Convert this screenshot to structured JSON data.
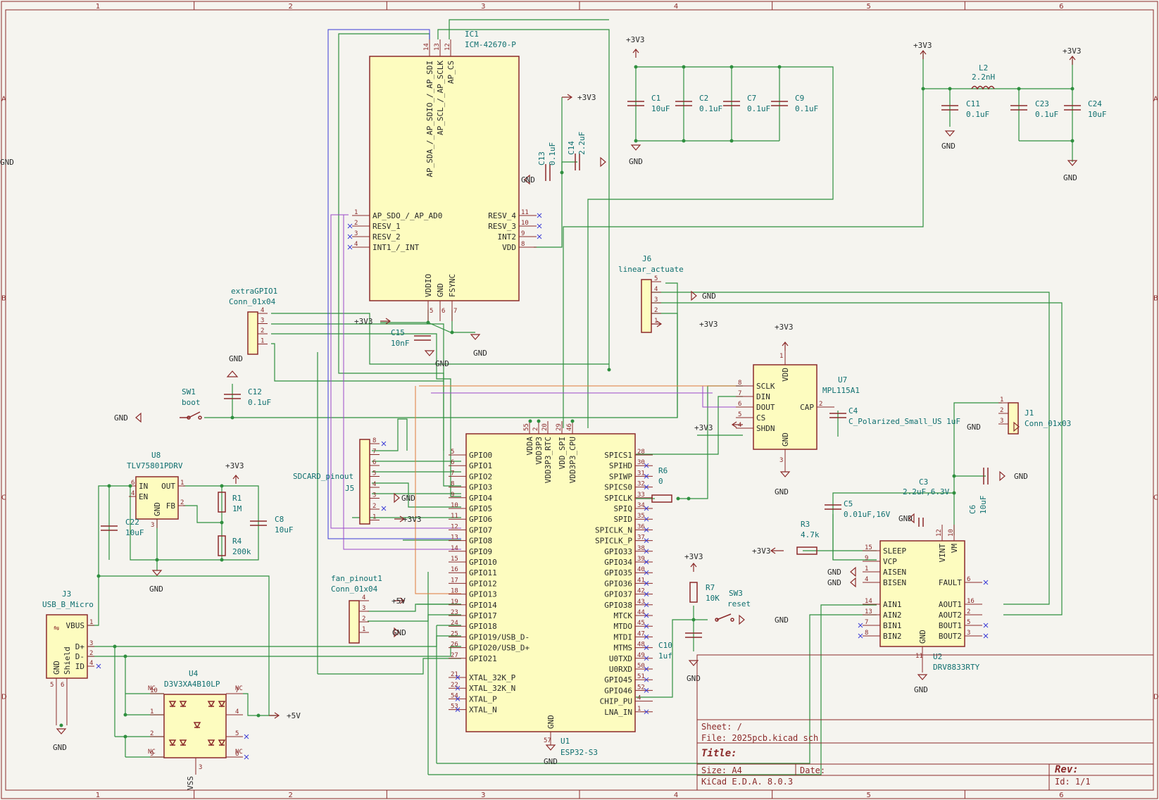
{
  "grid": {
    "cols": [
      "1",
      "2",
      "3",
      "4",
      "5",
      "6"
    ],
    "rows": [
      "A",
      "B",
      "C",
      "D"
    ]
  },
  "ic1": {
    "ref": "IC1",
    "value": "ICM-42670-P",
    "top_pins": [
      {
        "num": "14",
        "name": "AP_SDA_/_AP_SDIO_/_AP_SDI"
      },
      {
        "num": "13",
        "name": "AP_SCL_/_AP_SCLK"
      },
      {
        "num": "12",
        "name": "AP_CS"
      }
    ],
    "left_pins": [
      {
        "num": "1",
        "name": "AP_SDO_/_AP_AD0"
      },
      {
        "num": "2",
        "name": "RESV_1"
      },
      {
        "num": "3",
        "name": "RESV_2"
      },
      {
        "num": "4",
        "name": "INT1_/_INT"
      }
    ],
    "right_pins": [
      {
        "num": "11",
        "name": "RESV_4"
      },
      {
        "num": "10",
        "name": "RESV_3"
      },
      {
        "num": "9",
        "name": "INT2"
      },
      {
        "num": "8",
        "name": "VDD"
      }
    ],
    "bottom_pins": [
      {
        "num": "5",
        "name": "VDDIO"
      },
      {
        "num": "6",
        "name": "GND"
      },
      {
        "num": "7",
        "name": "FSYNC"
      }
    ]
  },
  "u1": {
    "ref": "U1",
    "value": "ESP32-S3",
    "top_pins": [
      {
        "num": "55",
        "name": "VDDA"
      },
      {
        "num": "2",
        "name": "VDD3P3"
      },
      {
        "num": "20",
        "name": "VDD3P3_RTC"
      },
      {
        "num": "29",
        "name": "VDD_SPI"
      },
      {
        "num": "46",
        "name": "VDD3P3_CPU"
      }
    ],
    "left_pins": [
      {
        "num": "5",
        "name": "GPIO0"
      },
      {
        "num": "6",
        "name": "GPIO1"
      },
      {
        "num": "7",
        "name": "GPIO2"
      },
      {
        "num": "8",
        "name": "GPIO3"
      },
      {
        "num": "9",
        "name": "GPIO4"
      },
      {
        "num": "10",
        "name": "GPIO5"
      },
      {
        "num": "11",
        "name": "GPIO6"
      },
      {
        "num": "12",
        "name": "GPIO7"
      },
      {
        "num": "13",
        "name": "GPIO8"
      },
      {
        "num": "14",
        "name": "GPIO9"
      },
      {
        "num": "15",
        "name": "GPIO10"
      },
      {
        "num": "16",
        "name": "GPIO11"
      },
      {
        "num": "17",
        "name": "GPIO12"
      },
      {
        "num": "18",
        "name": "GPIO13"
      },
      {
        "num": "19",
        "name": "GPIO14"
      },
      {
        "num": "23",
        "name": "GPIO17"
      },
      {
        "num": "24",
        "name": "GPIO18"
      },
      {
        "num": "25",
        "name": "GPIO19/USB_D-"
      },
      {
        "num": "26",
        "name": "GPIO20/USB_D+"
      },
      {
        "num": "27",
        "name": "GPIO21"
      },
      {
        "num": "21",
        "name": "XTAL_32K_P"
      },
      {
        "num": "22",
        "name": "XTAL_32K_N"
      },
      {
        "num": "54",
        "name": "XTAL_P"
      },
      {
        "num": "53",
        "name": "XTAL_N"
      }
    ],
    "right_pins": [
      {
        "num": "28",
        "name": "SPICS1"
      },
      {
        "num": "30",
        "name": "SPIHD"
      },
      {
        "num": "31",
        "name": "SPIWP"
      },
      {
        "num": "32",
        "name": "SPICS0"
      },
      {
        "num": "33",
        "name": "SPICLK"
      },
      {
        "num": "34",
        "name": "SPIQ"
      },
      {
        "num": "35",
        "name": "SPID"
      },
      {
        "num": "36",
        "name": "SPICLK_N"
      },
      {
        "num": "37",
        "name": "SPICLK_P"
      },
      {
        "num": "38",
        "name": "GPIO33"
      },
      {
        "num": "39",
        "name": "GPIO34"
      },
      {
        "num": "40",
        "name": "GPIO35"
      },
      {
        "num": "41",
        "name": "GPIO36"
      },
      {
        "num": "42",
        "name": "GPIO37"
      },
      {
        "num": "43",
        "name": "GPIO38"
      },
      {
        "num": "44",
        "name": "MTCK"
      },
      {
        "num": "45",
        "name": "MTDO"
      },
      {
        "num": "47",
        "name": "MTDI"
      },
      {
        "num": "48",
        "name": "MTMS"
      },
      {
        "num": "49",
        "name": "U0TXD"
      },
      {
        "num": "50",
        "name": "U0RXD"
      },
      {
        "num": "51",
        "name": "GPIO45"
      },
      {
        "num": "52",
        "name": "GPIO46"
      },
      {
        "num": "4",
        "name": "CHIP_PU"
      },
      {
        "num": "1",
        "name": "LNA_IN"
      }
    ],
    "bottom_pins": [
      {
        "num": "57",
        "name": "GND"
      }
    ]
  },
  "u7": {
    "ref": "U7",
    "value": "MPL115A1",
    "left_pins": [
      {
        "num": "8",
        "name": "SCLK"
      },
      {
        "num": "7",
        "name": "DIN"
      },
      {
        "num": "6",
        "name": "DOUT"
      },
      {
        "num": "5",
        "name": "CS"
      },
      {
        "num": "4",
        "name": "SHDN"
      }
    ],
    "top_pin": {
      "num": "1",
      "name": "VDD"
    },
    "bottom_pin": {
      "num": "3",
      "name": "GND"
    },
    "right_pin": {
      "num": "2",
      "name": "CAP"
    }
  },
  "u2": {
    "ref": "U2",
    "value": "DRV8833RTY",
    "left_pins": [
      {
        "num": "15",
        "name": "SLEEP"
      },
      {
        "num": "9",
        "name": "VCP"
      },
      {
        "num": "1",
        "name": "AISEN"
      },
      {
        "num": "4",
        "name": "BISEN"
      },
      {
        "num": "14",
        "name": "AIN1"
      },
      {
        "num": "13",
        "name": "AIN2"
      },
      {
        "num": "7",
        "name": "BIN1"
      },
      {
        "num": "8",
        "name": "BIN2"
      }
    ],
    "right_pins": [
      {
        "num": "6",
        "name": "FAULT"
      },
      {
        "num": "16",
        "name": "AOUT1"
      },
      {
        "num": "2",
        "name": "AOUT2"
      },
      {
        "num": "5",
        "name": "BOUT1"
      },
      {
        "num": "3",
        "name": "BOUT2"
      }
    ],
    "top_pins": [
      {
        "num": "12",
        "name": "VINT"
      },
      {
        "num": "10",
        "name": "VM"
      }
    ],
    "bottom_pin": {
      "num": "11",
      "name": "GND"
    }
  },
  "u8": {
    "ref": "U8",
    "value": "TLV75801PDRV",
    "pins": [
      {
        "num": "6",
        "name": "IN"
      },
      {
        "num": "4",
        "name": "EN"
      },
      {
        "num": "1",
        "name": "OUT"
      },
      {
        "num": "2",
        "name": "FB"
      },
      {
        "num": "3",
        "name": "GND"
      }
    ]
  },
  "u4": {
    "ref": "U4",
    "value": "D3V3XA4B10LP",
    "nc": "NC",
    "vss": "VSS",
    "pins": [
      "10",
      "1",
      "2",
      "9",
      "7",
      "4",
      "5",
      "6",
      "3"
    ]
  },
  "j3": {
    "ref": "J3",
    "value": "USB_B_Micro",
    "pins": [
      {
        "num": "1",
        "name": "VBUS"
      },
      {
        "num": "3",
        "name": "D+"
      },
      {
        "num": "2",
        "name": "D-"
      },
      {
        "num": "4",
        "name": "ID"
      },
      {
        "num": "6",
        "name": "Shield"
      },
      {
        "num": "5",
        "name": "GND"
      }
    ]
  },
  "j5": {
    "ref": "J5",
    "value": "SDCARD_pinout",
    "pins": [
      "8",
      "7",
      "6",
      "5",
      "4",
      "3",
      "2",
      "1"
    ]
  },
  "j6": {
    "ref": "J6",
    "value": "linear_actuate",
    "pins": [
      "5",
      "4",
      "3",
      "2",
      "1"
    ]
  },
  "j1": {
    "ref": "J1",
    "value": "Conn_01x03",
    "pins": [
      "1",
      "2",
      "3"
    ]
  },
  "extra": {
    "ref": "extraGPIO1",
    "value": "Conn_01x04",
    "pins": [
      "4",
      "3",
      "2",
      "1"
    ]
  },
  "fan": {
    "ref": "fan_pinout1",
    "value": "Conn_01x04",
    "pins": [
      "4",
      "3",
      "2",
      "1"
    ]
  },
  "sw1": {
    "ref": "SW1",
    "value": "boot"
  },
  "sw3": {
    "ref": "SW3",
    "value": "reset"
  },
  "caps": {
    "c1": {
      "ref": "C1",
      "value": "10uF"
    },
    "c2": {
      "ref": "C2",
      "value": "0.1uF"
    },
    "c7": {
      "ref": "C7",
      "value": "0.1uF"
    },
    "c9": {
      "ref": "C9",
      "value": "0.1uF"
    },
    "c11": {
      "ref": "C11",
      "value": "0.1uF"
    },
    "c23": {
      "ref": "C23",
      "value": "0.1uF"
    },
    "c24": {
      "ref": "C24",
      "value": "10uF"
    },
    "c13": {
      "ref": "C13",
      "value": "0.1uF"
    },
    "c14": {
      "ref": "C14",
      "value": "2.2uF"
    },
    "c15": {
      "ref": "C15",
      "value": "10nF"
    },
    "c12": {
      "ref": "C12",
      "value": "0.1uF"
    },
    "c22": {
      "ref": "C22",
      "value": "10uF"
    },
    "c8": {
      "ref": "C8",
      "value": "10uF"
    },
    "c4": {
      "ref": "C4",
      "value": "C_Polarized_Small_US 1uF"
    },
    "c3": {
      "ref": "C3",
      "value": "2.2uF,6.3V"
    },
    "c6": {
      "ref": "C6",
      "value": "10uF"
    },
    "c5": {
      "ref": "C5",
      "value": "0.01uF,16V"
    },
    "c10": {
      "ref": "C10",
      "value": "1uf"
    }
  },
  "res": {
    "r1": {
      "ref": "R1",
      "value": "1M"
    },
    "r4": {
      "ref": "R4",
      "value": "200k"
    },
    "r6": {
      "ref": "R6",
      "value": "0"
    },
    "r3": {
      "ref": "R3",
      "value": "4.7k"
    },
    "r7": {
      "ref": "R7",
      "value": "10K"
    }
  },
  "l2": {
    "ref": "L2",
    "value": "2.2nH"
  },
  "nets": {
    "v33": "+3V3",
    "v5": "+5V",
    "gnd": "GND"
  },
  "title_block": {
    "sheet": "Sheet: /",
    "file": "File: 2025pcb.kicad_sch",
    "title": "Title:",
    "size": "Size: A4",
    "date": "Date:",
    "tool": "KiCad E.D.A. 8.0.3",
    "rev": "Rev:",
    "id": "Id: 1/1"
  }
}
